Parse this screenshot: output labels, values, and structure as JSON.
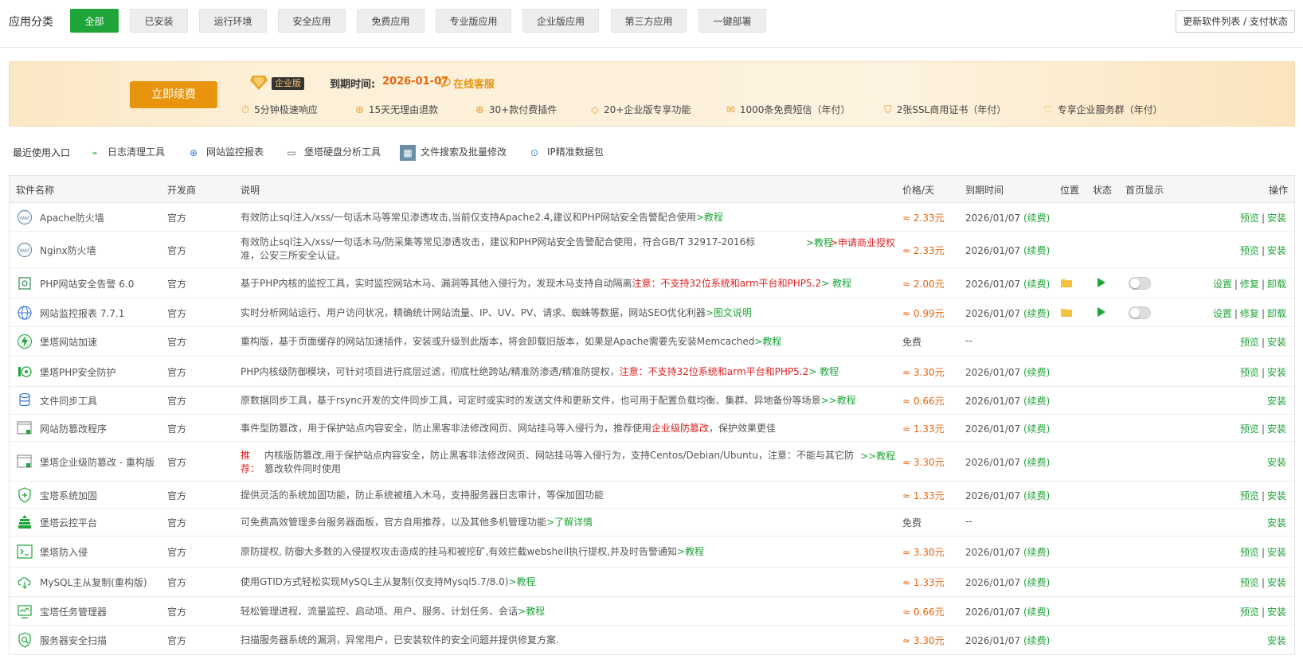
{
  "categories": {
    "label": "应用分类",
    "items": [
      "全部",
      "已安装",
      "运行环境",
      "安全应用",
      "免费应用",
      "专业版应用",
      "企业版应用",
      "第三方应用",
      "一键部署"
    ],
    "active_index": 0,
    "update_button": "更新软件列表 / 支付状态"
  },
  "banner": {
    "renew_button": "立即续费",
    "badge": "企业版",
    "expire_label": "到期时间:",
    "expire_date": "2026-01-07",
    "online_cs": "在线客服",
    "features": [
      "5分钟极速响应",
      "15天无理由退款",
      "30+款付费插件",
      "20+企业版专享功能",
      "1000条免费短信（年付）",
      "2张SSL商用证书（年付）",
      "专享企业服务群（年付）"
    ]
  },
  "recent": {
    "label": "最近使用入口",
    "items": [
      "日志清理工具",
      "网站监控报表",
      "堡塔硬盘分析工具",
      "文件搜索及批量修改",
      "IP精准数据包"
    ]
  },
  "table": {
    "headers": {
      "name": "软件名称",
      "developer": "开发商",
      "description": "说明",
      "price": "价格/天",
      "expire": "到期时间",
      "position": "位置",
      "status": "状态",
      "homepage": "首页显示",
      "ops": "操作"
    },
    "rows": [
      {
        "name": "Apache防火墙",
        "dev": "官方",
        "desc": "有效防止sql注入/xss/一句话木马等常见渗透攻击,当前仅支持Apache2.4,建议和PHP网站安全告警配合使用",
        "link": ">教程",
        "price": "≈ 2.33元",
        "expire": "2026/01/07",
        "renew": "(续费)",
        "ops": [
          "预览",
          "安装"
        ]
      },
      {
        "name": "Nginx防火墙",
        "dev": "官方",
        "desc": "有效防止sql注入/xss/一句话木马/防采集等常见渗透攻击，建议和PHP网站安全告警配合使用，符合GB/T 32917-2016标准，公安三所安全认证。",
        "link": ">教程",
        "link2": ">申请商业授权",
        "price": "≈ 2.33元",
        "expire": "2026/01/07",
        "renew": "(续费)",
        "ops": [
          "预览",
          "安装"
        ]
      },
      {
        "name": "PHP网站安全告警 6.0",
        "dev": "官方",
        "desc": "基于PHP内核的监控工具，实时监控网站木马、漏洞等其他入侵行为，发现木马支持自动隔离",
        "warn": "注意：不支持32位系统和arm平台和PHP5.2",
        "link": "> 教程",
        "price": "≈ 2.00元",
        "expire": "2026/01/07",
        "renew": "(续费)",
        "ops": [
          "设置",
          "修复",
          "卸载"
        ]
      },
      {
        "name": "网站监控报表 7.7.1",
        "dev": "官方",
        "desc": "实时分析网站运行、用户访问状况，精确统计网站流量、IP、UV、PV、请求、蜘蛛等数据，网站SEO优化利器",
        "link": ">图文说明",
        "price": "≈ 0.99元",
        "expire": "2026/01/07",
        "renew": "(续费)",
        "ops": [
          "设置",
          "修复",
          "卸载"
        ]
      },
      {
        "name": "堡塔网站加速",
        "dev": "官方",
        "desc": "重构版，基于页面缓存的网站加速插件，安装或升级到此版本，将会卸载旧版本，如果是Apache需要先安装Memcached",
        "link": ">教程",
        "price": "免费",
        "expire": "--",
        "renew": "",
        "ops": [
          "预览",
          "安装"
        ]
      },
      {
        "name": "堡塔PHP安全防护",
        "dev": "官方",
        "desc": "PHP内核级防御模块，可针对项目进行底层过滤，彻底杜绝跨站/精准防渗透/精准防提权，",
        "warn": "注意：不支持32位系统和arm平台和PHP5.2",
        "link": "> 教程",
        "price": "≈ 3.30元",
        "expire": "2026/01/07",
        "renew": "(续费)",
        "ops": [
          "预览",
          "安装"
        ]
      },
      {
        "name": "文件同步工具",
        "dev": "官方",
        "desc": "原数据同步工具，基于rsync开发的文件同步工具，可定时或实时的发送文件和更新文件，也可用于配置负载均衡、集群、异地备份等场景",
        "link": ">>教程",
        "price": "≈ 0.66元",
        "expire": "2026/01/07",
        "renew": "(续费)",
        "ops": [
          "安装"
        ]
      },
      {
        "name": "网站防篡改程序",
        "dev": "官方",
        "desc": "事件型防篡改，用于保护站点内容安全，防止黑客非法修改网页、网站挂马等入侵行为，推荐使用",
        "warn": "企业级防篡改",
        "tail": "，保护效果更佳",
        "price": "≈ 1.33元",
        "expire": "2026/01/07",
        "renew": "(续费)",
        "ops": [
          "预览",
          "安装"
        ]
      },
      {
        "name": "堡塔企业级防篡改 - 重构版",
        "dev": "官方",
        "tag": "推荐：",
        "desc": "内核版防篡改,用于保护站点内容安全，防止黑客非法修改网页、网站挂马等入侵行为，支持Centos/Debian/Ubuntu，注意：不能与其它防篡改软件同时使用",
        "link": ">>教程",
        "price": "≈ 3.30元",
        "expire": "2026/01/07",
        "renew": "(续费)",
        "ops": [
          "安装"
        ]
      },
      {
        "name": "宝塔系统加固",
        "dev": "官方",
        "desc": "提供灵活的系统加固功能，防止系统被植入木马，支持服务器日志审计，等保加固功能",
        "price": "≈ 1.33元",
        "expire": "2026/01/07",
        "renew": "(续费)",
        "ops": [
          "预览",
          "安装"
        ]
      },
      {
        "name": "堡塔云控平台",
        "dev": "官方",
        "desc": "可免费高效管理多台服务器面板，官方自用推荐，以及其他多机管理功能",
        "link": ">了解详情",
        "price": "免费",
        "expire": "--",
        "renew": "",
        "ops": [
          "安装"
        ]
      },
      {
        "name": "堡塔防入侵",
        "dev": "官方",
        "desc": "原防提权, 防御大多数的入侵提权攻击造成的挂马和被挖矿,有效拦截webshell执行提权,并及时告警通知",
        "link": ">教程",
        "price": "≈ 3.30元",
        "expire": "2026/01/07",
        "renew": "(续费)",
        "ops": [
          "预览",
          "安装"
        ]
      },
      {
        "name": "MySQL主从复制(重构版)",
        "dev": "官方",
        "desc": "使用GTID方式轻松实现MySQL主从复制(仅支持Mysql5.7/8.0)",
        "link": ">教程",
        "price": "≈ 1.33元",
        "expire": "2026/01/07",
        "renew": "(续费)",
        "ops": [
          "预览",
          "安装"
        ]
      },
      {
        "name": "宝塔任务管理器",
        "dev": "官方",
        "desc": "轻松管理进程、流量监控、启动项、用户、服务、计划任务、会话",
        "link": ">教程",
        "price": "≈ 0.66元",
        "expire": "2026/01/07",
        "renew": "(续费)",
        "ops": [
          "预览",
          "安装"
        ]
      },
      {
        "name": "服务器安全扫描",
        "dev": "官方",
        "desc": "扫描服务器系统的漏洞，异常用户，已安装软件的安全问题并提供修复方案.",
        "price": "≈ 3.30元",
        "expire": "2026/01/07",
        "renew": "(续费)",
        "ops": [
          "安装"
        ]
      }
    ]
  }
}
